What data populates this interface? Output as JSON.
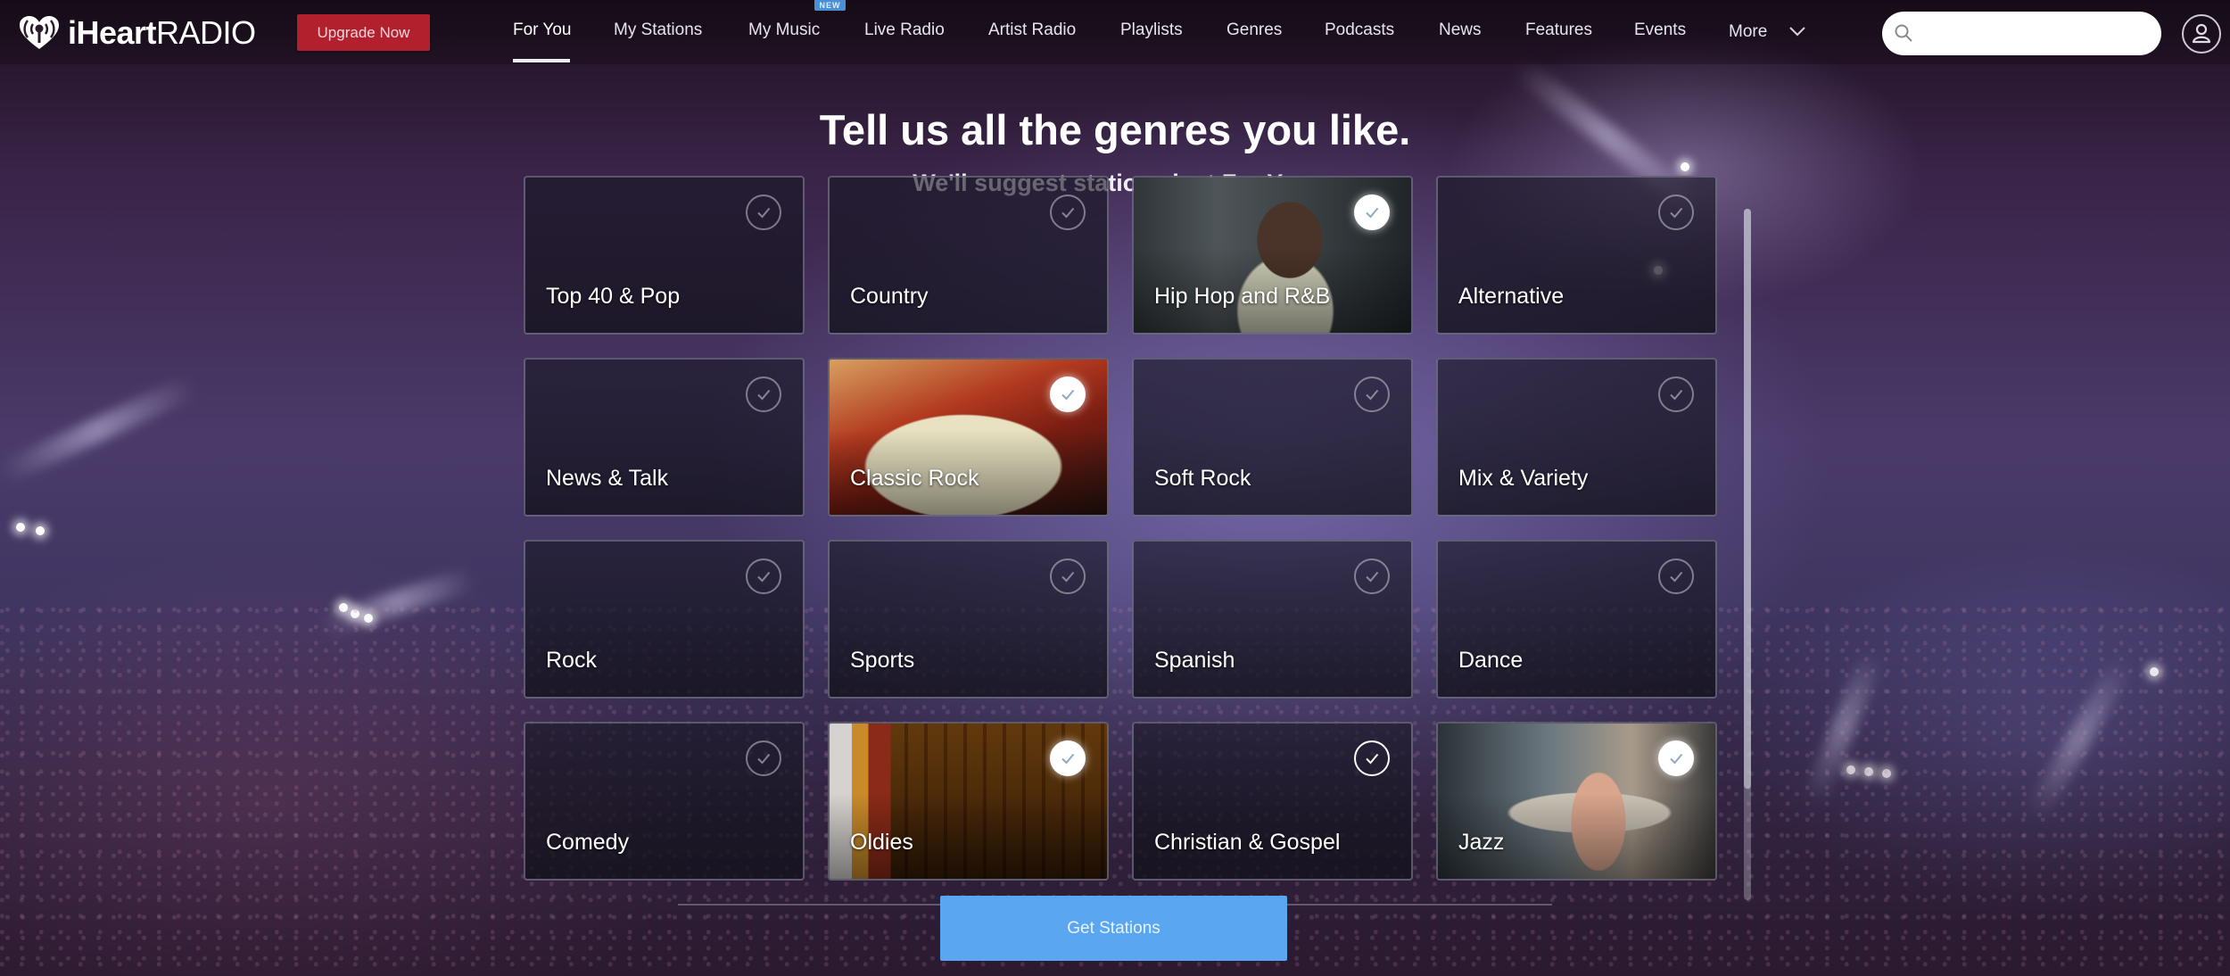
{
  "header": {
    "logo": {
      "bold": "iHeart",
      "light": "RADIO",
      "icon": "iheart-logo-icon"
    },
    "upgrade_label": "Upgrade Now",
    "nav": [
      {
        "label": "For You",
        "active": true
      },
      {
        "label": "My Stations",
        "active": false
      },
      {
        "label": "My Music",
        "active": false,
        "badge": "NEW"
      },
      {
        "label": "Live Radio",
        "active": false
      },
      {
        "label": "Artist Radio",
        "active": false
      },
      {
        "label": "Playlists",
        "active": false
      },
      {
        "label": "Genres",
        "active": false
      },
      {
        "label": "Podcasts",
        "active": false
      },
      {
        "label": "News",
        "active": false
      },
      {
        "label": "Features",
        "active": false
      },
      {
        "label": "Events",
        "active": false
      },
      {
        "label": "More",
        "active": false,
        "icon": "chevron-down-icon"
      }
    ],
    "search": {
      "value": "",
      "placeholder": "",
      "icon": "search-icon"
    },
    "user_icon": "user-icon"
  },
  "main": {
    "title": "Tell us all the genres you like.",
    "subtitle": "We'll suggest stations just For You.",
    "genres": [
      {
        "label": "Top 40 & Pop",
        "state": "unselected"
      },
      {
        "label": "Country",
        "state": "unselected"
      },
      {
        "label": "Hip Hop and R&B",
        "state": "selected"
      },
      {
        "label": "Alternative",
        "state": "unselected"
      },
      {
        "label": "News & Talk",
        "state": "unselected"
      },
      {
        "label": "Classic Rock",
        "state": "selected"
      },
      {
        "label": "Soft Rock",
        "state": "unselected"
      },
      {
        "label": "Mix & Variety",
        "state": "unselected"
      },
      {
        "label": "Rock",
        "state": "unselected"
      },
      {
        "label": "Sports",
        "state": "unselected"
      },
      {
        "label": "Spanish",
        "state": "unselected"
      },
      {
        "label": "Dance",
        "state": "unselected"
      },
      {
        "label": "Comedy",
        "state": "unselected"
      },
      {
        "label": "Oldies",
        "state": "selected"
      },
      {
        "label": "Christian & Gospel",
        "state": "hover"
      },
      {
        "label": "Jazz",
        "state": "selected"
      }
    ],
    "get_stations_label": "Get Stations"
  },
  "colors": {
    "upgrade": "#b2202e",
    "get_stations": "#5aa6f0",
    "new_badge": "#4a8fd6"
  }
}
